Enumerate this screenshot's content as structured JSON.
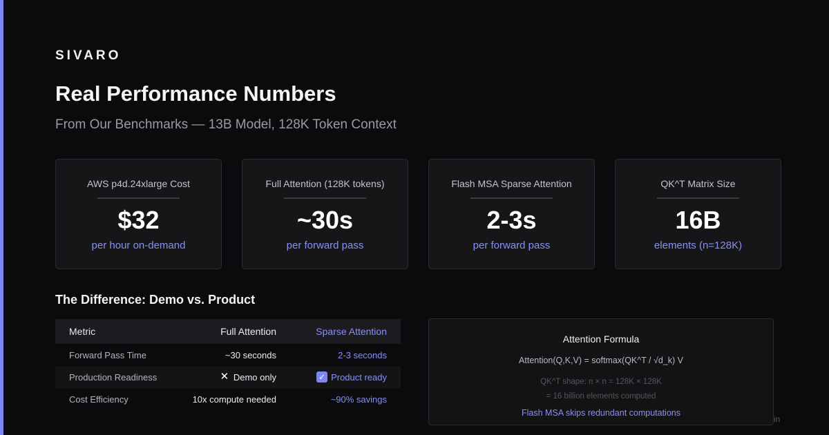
{
  "brand": "SIVARO",
  "title": "Real Performance Numbers",
  "subtitle": "From Our Benchmarks — 13B Model, 128K Token Context",
  "cards": [
    {
      "label": "AWS p4d.24xlarge Cost",
      "value": "$32",
      "note": "per hour on-demand"
    },
    {
      "label": "Full Attention (128K tokens)",
      "value": "~30s",
      "note": "per forward pass"
    },
    {
      "label": "Flash MSA Sparse Attention",
      "value": "2-3s",
      "note": "per forward pass"
    },
    {
      "label": "QK^T Matrix Size",
      "value": "16B",
      "note": "elements (n=128K)"
    }
  ],
  "comparison": {
    "title": "The Difference: Demo vs. Product",
    "headers": {
      "metric": "Metric",
      "full": "Full Attention",
      "sparse": "Sparse Attention"
    },
    "rows": [
      {
        "metric": "Forward Pass Time",
        "full": "~30 seconds",
        "sparse": "2-3 seconds"
      },
      {
        "metric": "Production Readiness",
        "full": "Demo only",
        "full_icon": "✕",
        "sparse": "Product ready",
        "sparse_icon": "✓"
      },
      {
        "metric": "Cost Efficiency",
        "full": "10x compute needed",
        "sparse": "~90% savings"
      }
    ]
  },
  "formula": {
    "title": "Attention Formula",
    "equation": "Attention(Q,K,V) = softmax(QK^T / √d_k) V",
    "shape": "QK^T shape: n × n = 128K × 128K",
    "count": "= 16 billion elements computed",
    "note": "Flash MSA skips redundant computations"
  },
  "corner_text": "in",
  "colors": {
    "accent": "#7f86f2",
    "background": "#0b0b0d",
    "card": "#161619"
  }
}
